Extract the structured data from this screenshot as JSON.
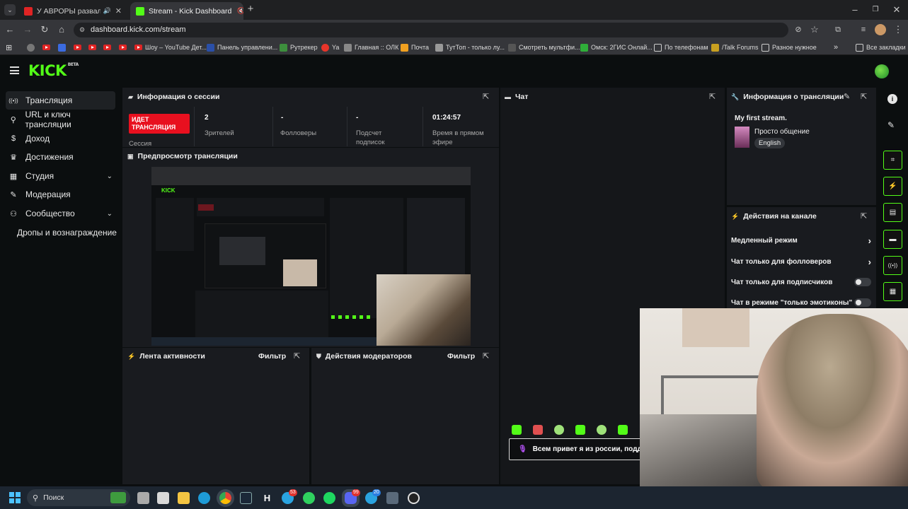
{
  "browser": {
    "tabs": [
      {
        "label": "У АВРОРЫ развалилось Кэ",
        "close": "✕"
      },
      {
        "label": "Stream - Kick Dashboard",
        "close": "✕"
      }
    ],
    "new_tab": "+",
    "url": "dashboard.kick.com/stream",
    "bookmarks": [
      "Шоу – YouTube Дет...",
      "Панель управлени...",
      "Рутрекер",
      "Ya",
      "Главная :: ОЛК",
      "Почта",
      "ТутТоп - только лу...",
      "Смотреть мультфи...",
      "Омск: 2ГИС Онлай...",
      "По телефонам",
      "/Talk Forums",
      "Разное нужное"
    ],
    "bookmarks_more": "»",
    "all_bookmarks": "Все закладки"
  },
  "kick": {
    "logo": "KICK",
    "logo_badge": "BETA"
  },
  "sidebar": {
    "items": [
      {
        "icon": "((•))",
        "label": "Трансляция"
      },
      {
        "icon": "⚲",
        "label": "URL и ключ трансляции"
      },
      {
        "icon": "$",
        "label": "Доход"
      },
      {
        "icon": "♛",
        "label": "Достижения"
      },
      {
        "icon": "▦",
        "label": "Студия",
        "chevron": "⌄"
      },
      {
        "icon": "✎",
        "label": "Модерация"
      },
      {
        "icon": "⚇",
        "label": "Сообщество",
        "chevron": "⌄"
      },
      {
        "icon": "",
        "label": "Дропы и вознаграждение"
      }
    ]
  },
  "session": {
    "title": "Информация о сессии",
    "live_badge": "ИДЕТ ТРАНСЛЯЦИЯ",
    "session_label": "Сессия",
    "viewers_value": "2",
    "viewers_label": "Зрителей",
    "followers_value": "-",
    "followers_label": "Фолловеры",
    "subs_value": "-",
    "subs_label": "Подсчет подписок",
    "uptime_value": "01:24:57",
    "uptime_label": "Время в прямом эфире"
  },
  "preview": {
    "title": "Предпросмотр трансляции"
  },
  "activity": {
    "title": "Лента активности",
    "filter": "Фильтр"
  },
  "modactions": {
    "title": "Действия модераторов",
    "filter": "Фильтр"
  },
  "chat": {
    "title": "Чат",
    "message": "Всем привет я из россии, поддер"
  },
  "stream_info": {
    "title": "Информация о трансляции",
    "stream_title": "My first stream.",
    "category": "Просто общение",
    "language": "English"
  },
  "channel_actions": {
    "title": "Действия на канале",
    "rows": [
      {
        "label": "Медленный режим",
        "control": "chevron"
      },
      {
        "label": "Чат только для фолловеров",
        "control": "chevron"
      },
      {
        "label": "Чат только для подписчиков",
        "control": "toggle"
      },
      {
        "label": "Чат в режиме \"только эмотиконы\"",
        "control": "toggle"
      }
    ]
  },
  "taskbar": {
    "search": "Поиск",
    "badges": [
      "53",
      "99",
      "20"
    ]
  },
  "colors": {
    "kick_green": "#53fc18",
    "live_red": "#e8101f",
    "panel_bg": "#191b1f",
    "page_bg": "#0b0e0f"
  }
}
